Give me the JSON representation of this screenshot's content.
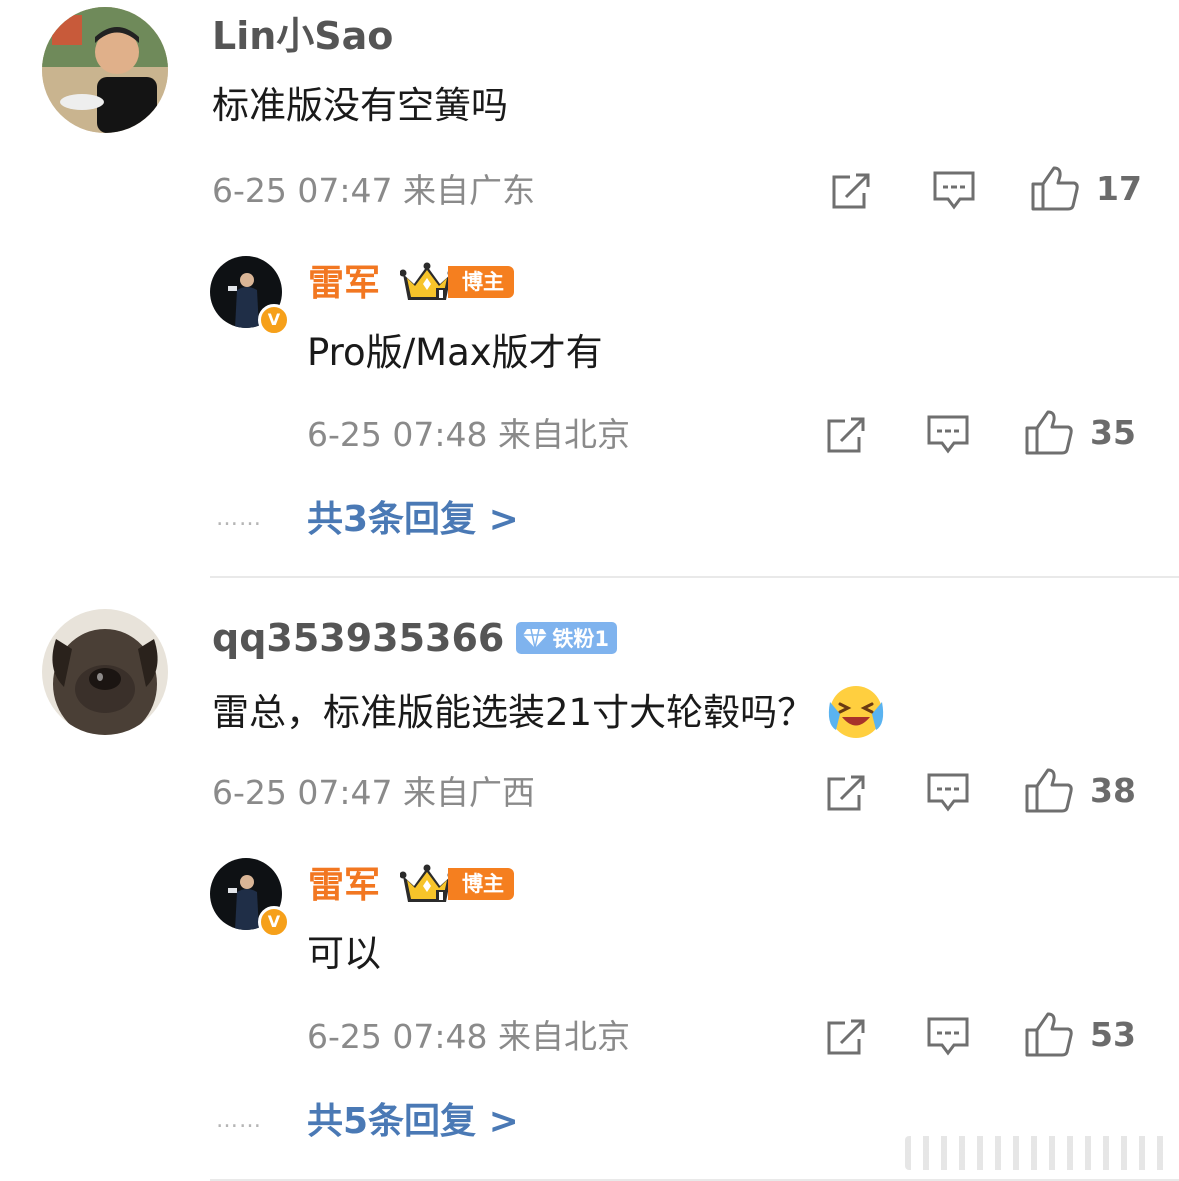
{
  "comments": [
    {
      "username": "Lin小Sao",
      "text": "标准版没有空簧吗",
      "time": "6-25 07:47",
      "location": "来自广东",
      "likes": "17",
      "reply": {
        "username": "雷军",
        "badge": "博主",
        "text": "Pro版/Max版才有",
        "time": "6-25 07:48",
        "location": "来自北京",
        "likes": "35"
      },
      "more_dots": "……",
      "more_replies": "共3条回复 >"
    },
    {
      "username": "qq353935366",
      "fan_badge": "铁粉1",
      "text": "雷总，标准版能选装21寸大轮毂吗？",
      "emoji": "laughing-crying-emoji",
      "time": "6-25 07:47",
      "location": "来自广西",
      "likes": "38",
      "reply": {
        "username": "雷军",
        "badge": "博主",
        "text": "可以",
        "time": "6-25 07:48",
        "location": "来自北京",
        "likes": "53"
      },
      "more_dots": "……",
      "more_replies": "共5条回复 >"
    }
  ],
  "icons": {
    "repost": "repost-icon",
    "comment": "comment-icon",
    "like": "thumbs-up-icon",
    "crown": "crown-icon",
    "diamond": "diamond-icon",
    "verified": "verified-badge-icon"
  },
  "colors": {
    "blogger_name": "#f27721",
    "link_blue": "#4a79b5",
    "badge_orange": "#f57f1f",
    "fan_badge_blue": "#7fb3ee"
  }
}
